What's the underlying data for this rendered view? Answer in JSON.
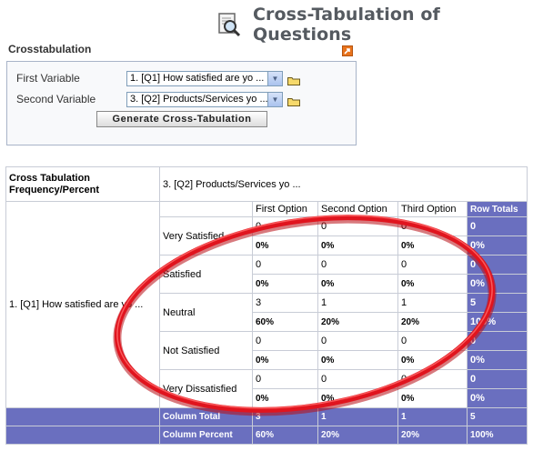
{
  "page": {
    "title": "Cross-Tabulation of Questions"
  },
  "panel": {
    "title": "Crosstabulation",
    "first_label": "First Variable",
    "first_value": "1. [Q1] How satisfied are yo ...",
    "second_label": "Second Variable",
    "second_value": "3. [Q2] Products/Services yo ...",
    "generate_label": "Generate Cross-Tabulation"
  },
  "table": {
    "header_left": "Cross Tabulation Frequency/Percent",
    "column_variable": "3. [Q2] Products/Services yo ...",
    "row_variable": "1. [Q1] How satisfied are yo ...",
    "columns": [
      "First Option",
      "Second Option",
      "Third Option"
    ],
    "row_totals_label": "Row Totals",
    "rows": [
      {
        "label": "Very Satisfied",
        "counts": [
          "0",
          "0",
          "0"
        ],
        "percents": [
          "0%",
          "0%",
          "0%"
        ],
        "total": "0",
        "total_pct": "0%"
      },
      {
        "label": "Satisfied",
        "counts": [
          "0",
          "0",
          "0"
        ],
        "percents": [
          "0%",
          "0%",
          "0%"
        ],
        "total": "0",
        "total_pct": "0%"
      },
      {
        "label": "Neutral",
        "counts": [
          "3",
          "1",
          "1"
        ],
        "percents": [
          "60%",
          "20%",
          "20%"
        ],
        "total": "5",
        "total_pct": "100%"
      },
      {
        "label": "Not Satisfied",
        "counts": [
          "0",
          "0",
          "0"
        ],
        "percents": [
          "0%",
          "0%",
          "0%"
        ],
        "total": "0",
        "total_pct": "0%"
      },
      {
        "label": "Very Dissatisfied",
        "counts": [
          "0",
          "0",
          "0"
        ],
        "percents": [
          "0%",
          "0%",
          "0%"
        ],
        "total": "0",
        "total_pct": "0%"
      }
    ],
    "column_total_label": "Column Total",
    "column_totals": [
      "3",
      "1",
      "1",
      "5"
    ],
    "column_percent_label": "Column Percent",
    "column_percents": [
      "60%",
      "20%",
      "20%",
      "100%"
    ]
  },
  "colors": {
    "totals_bg": "#6a6fbf",
    "annotation_oval": "#e0141e",
    "title_text": "#555a60"
  },
  "icons": [
    "magnifier-document-icon",
    "help-icon",
    "folder-icon",
    "dropdown-arrow-icon"
  ]
}
